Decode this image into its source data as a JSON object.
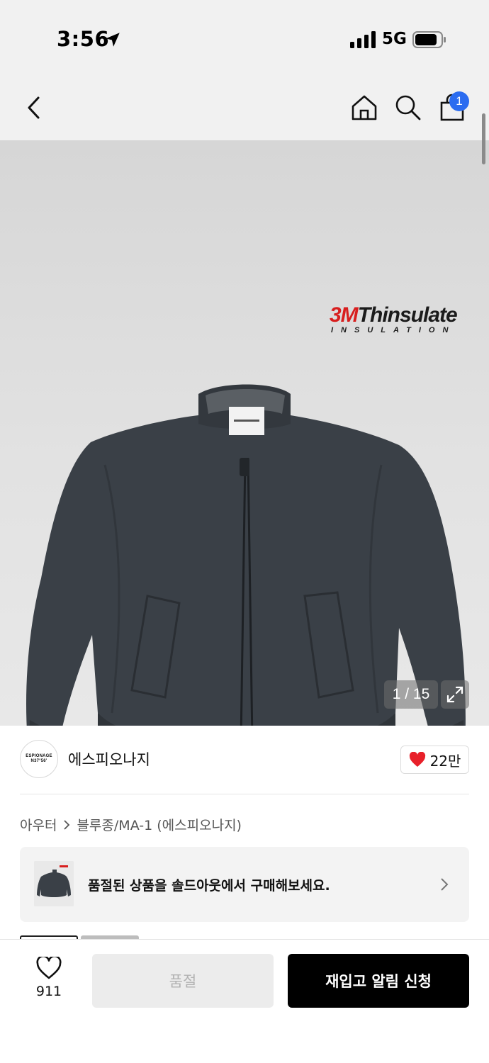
{
  "status_bar": {
    "time": "3:56",
    "network": "5G",
    "icons": [
      "location-arrow-icon",
      "signal-bars-icon",
      "battery-icon"
    ]
  },
  "nav": {
    "icons": [
      "chevron-left-icon",
      "home-icon",
      "search-icon",
      "shopping-bag-icon"
    ],
    "cart_badge": "1",
    "badge_color": "#2b6cf0"
  },
  "product_image": {
    "logo_brand": "3M",
    "logo_name": "Thinsulate",
    "logo_sub": "INSULATION",
    "counter": "1 / 15",
    "expand_icon": "expand-arrows-icon"
  },
  "brand": {
    "logo_text_line1": "ESPIONAGE",
    "logo_text_line2": "N37°56'",
    "name": "에스피오나지",
    "like_count": "22만",
    "heart_color": "#e8202a"
  },
  "breadcrumb": {
    "category": "아우터",
    "subcategory": "블루종/MA-1 (에스피오나지)"
  },
  "soldout_banner": {
    "text": "품절된 상품을 솔드아웃에서 구매해보세요."
  },
  "bottom_bar": {
    "wish_count": "911",
    "soldout_label": "품절",
    "restock_label": "재입고 알림 신청"
  }
}
